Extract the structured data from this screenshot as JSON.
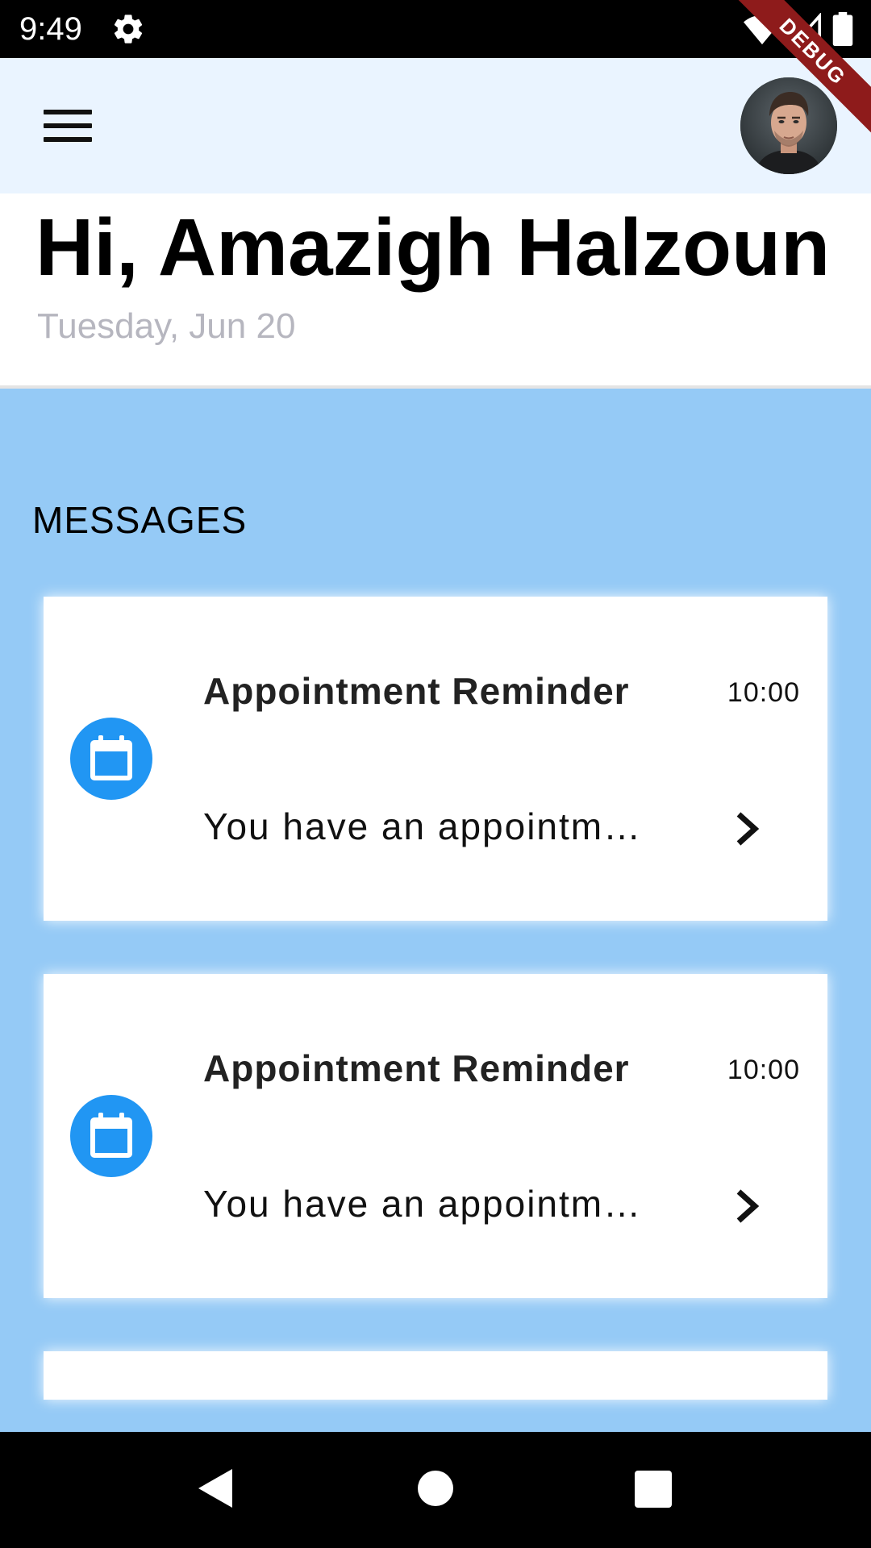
{
  "status_bar": {
    "time": "9:49",
    "debug_label": "DEBUG",
    "icons": [
      "settings-icon",
      "wifi-icon",
      "cell-signal-icon",
      "battery-icon"
    ]
  },
  "app_bar": {
    "menu_icon": "hamburger-menu-icon",
    "avatar": "user-avatar"
  },
  "greeting": {
    "title": "Hi, Amazigh Halzoun",
    "date": "Tuesday, Jun 20"
  },
  "messages": {
    "section_title": "MESSAGES",
    "items": [
      {
        "title": "Appointment Reminder",
        "time": "10:00",
        "body": "You have an appointm…",
        "icon": "calendar-icon"
      },
      {
        "title": "Appointment Reminder",
        "time": "10:00",
        "body": "You have an appointm…",
        "icon": "calendar-icon"
      },
      {
        "title": "",
        "time": "",
        "body": "",
        "icon": ""
      }
    ]
  },
  "colors": {
    "app_bar_bg": "#eaf4ff",
    "messages_bg": "#95caf6",
    "icon_accent": "#2196f3",
    "date_text": "#b6b6bf",
    "debug_ribbon": "#8e1b1b"
  },
  "nav_bar": {
    "icons": [
      "back-icon",
      "home-icon",
      "recents-icon"
    ]
  }
}
